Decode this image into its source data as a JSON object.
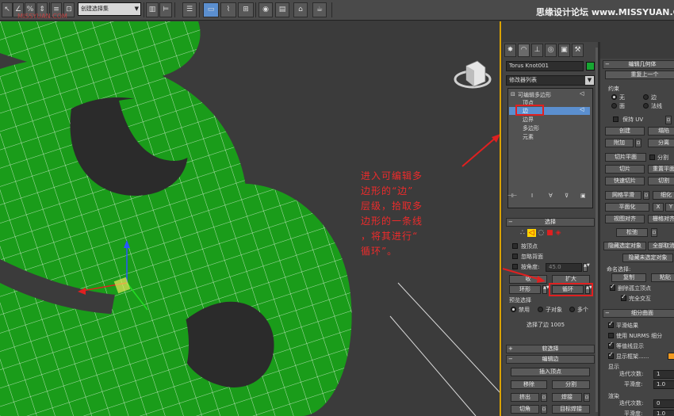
{
  "toolbar": {
    "percent_icon_label": "%",
    "selection_set_dropdown": "创建选择集",
    "subtitle_red": "MISSYUAN.COM",
    "watermark": "思缘设计论坛 www.MISSYUAN.COM"
  },
  "viewport": {
    "annotation_lines": [
      "进入可编辑多",
      "边形的“边”",
      "层级，拾取多",
      "边形的一条线",
      "，将其进行“",
      "循环”。"
    ],
    "colors": {
      "object": "#1a9c1a",
      "wire": "#ffffff",
      "background": "#3b3b3b",
      "annotation": "#ee2b2b",
      "viewport_border": "#d9a200"
    }
  },
  "command_panel": {
    "tabs": [
      "create-icon",
      "modify-icon",
      "hierarchy-icon",
      "motion-icon",
      "display-icon",
      "utilities-icon"
    ],
    "object_name": "Torus Knot001",
    "modifier_list_label": "修改器列表",
    "stack": {
      "root": "可编辑多边形",
      "items": [
        "顶点",
        "边",
        "边界",
        "多边形",
        "元素"
      ],
      "selected_index": 1
    },
    "selection": {
      "title": "选择",
      "by_vertex": "按顶点",
      "ignore_backfacing": "忽略背面",
      "by_angle_label": "按角度:",
      "by_angle_value": "45.0",
      "shrink": "收",
      "grow": "扩大",
      "ring": "环形",
      "loop": "循环",
      "preview_title": "预览选择",
      "preview_options": [
        "禁用",
        "子对象",
        "多个"
      ],
      "status": "选择了边 1005"
    },
    "soft_selection_title": "软选择",
    "edit_edges": {
      "title": "编辑边",
      "insert_vertex": "插入顶点",
      "remove": "移除",
      "split": "分割",
      "extrude": "挤出",
      "weld": "焊接",
      "chamfer": "切角",
      "target_weld": "目标焊接"
    }
  },
  "command_panel_2": {
    "edit_geometry_title": "编辑几何体",
    "repeat_last": "重复上一个",
    "constraints_title": "约束",
    "constraints": [
      "无",
      "边",
      "面",
      "法线"
    ],
    "preserve_uv": "保持 UV",
    "create": "创建",
    "collapse": "塌陷",
    "attach": "附加",
    "detach": "分离",
    "slice_plane": "切片平面",
    "split": "分割",
    "slice": "切片",
    "reset_plane": "重置平面",
    "quickslice": "快速切片",
    "cut": "切割",
    "meshsmooth": "网格平滑",
    "tessellate": "细化",
    "make_planar": "平面化",
    "x": "X",
    "y": "Y",
    "view_align": "视图对齐",
    "grid_align": "栅格对齐",
    "relax": "松弛",
    "hide_selected": "隐藏选定对象",
    "unhide_all": "全部取消",
    "hide_unselected": "隐藏未选定对象",
    "named_selections": "命名选择:",
    "copy": "复制",
    "paste": "粘贴",
    "delete_isolated": "删除孤立顶点",
    "full_interactivity": "完全交互",
    "subdivision_title": "细分曲面",
    "smooth_result": "平滑结果",
    "use_nurms": "使用 NURMS 细分",
    "isoline_display": "等值线显示",
    "show_cage": "显示框架......",
    "display_label": "显示",
    "iterations_label": "迭代次数:",
    "iterations_value": "1",
    "smoothness_label": "平滑度:",
    "smoothness_value": "1.0",
    "render_label": "渲染",
    "render_iterations_value": "0",
    "render_smoothness_value": "1.0"
  }
}
